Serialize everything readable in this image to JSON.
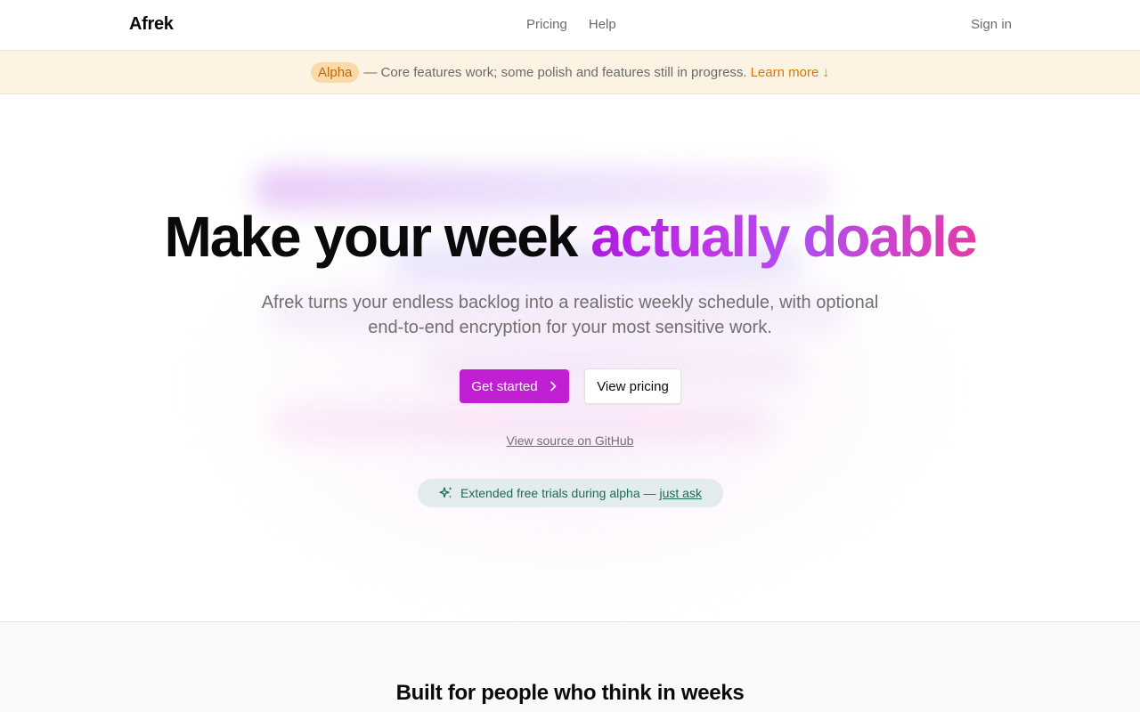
{
  "header": {
    "brand": "Afrek",
    "nav": [
      {
        "label": "Pricing"
      },
      {
        "label": "Help"
      }
    ],
    "sign_in": "Sign in"
  },
  "banner": {
    "badge": "Alpha",
    "text": "— Core features work; some polish and features still in progress.",
    "link": "Learn more ↓"
  },
  "hero": {
    "headline_plain": "Make your week",
    "headline_accent": "actually doable",
    "subtitle": "Afrek turns your endless backlog into a realistic weekly schedule, with optional end-to-end encryption for your most sensitive work.",
    "primary_button": "Get started",
    "secondary_button": "View pricing",
    "source_link": "View source on GitHub",
    "trial_text": "Extended free trials during alpha —",
    "trial_link": "just ask"
  },
  "section2": {
    "title": "Built for people who think in weeks"
  },
  "colors": {
    "accent": "#c01fd4",
    "banner_bg": "#fdf3e3",
    "badge_text": "#c2670a",
    "trial_text": "#1f6a55"
  },
  "icons": {
    "primary_button": "chevron-right-icon",
    "trial": "sparkles-icon"
  }
}
